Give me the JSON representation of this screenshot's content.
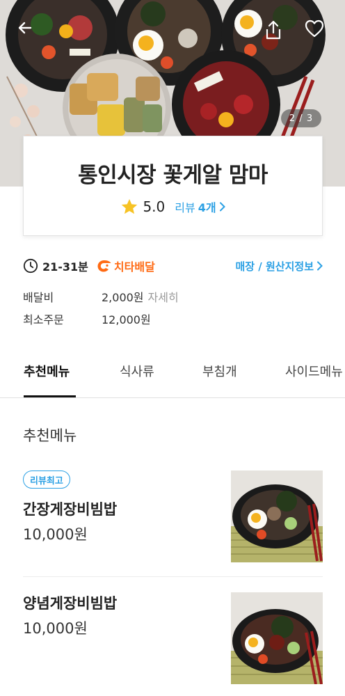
{
  "hero": {
    "image_counter": "2 / 3"
  },
  "store": {
    "name": "통인시장 꽃게알 맘마",
    "rating": "5.0",
    "review_label": "리뷰",
    "review_count": "4개"
  },
  "delivery": {
    "time": "21-31분",
    "cheetah_label": "치타배달",
    "origin_link": "매장 / 원산지정보",
    "fee_label": "배달비",
    "fee_value": "2,000원",
    "fee_detail": "자세히",
    "min_order_label": "최소주문",
    "min_order_value": "12,000원"
  },
  "tabs": [
    {
      "label": "추천메뉴",
      "active": true
    },
    {
      "label": "식사류"
    },
    {
      "label": "부침개"
    },
    {
      "label": "사이드메뉴"
    }
  ],
  "section": {
    "title": "추천메뉴"
  },
  "menu_items": [
    {
      "badge": "리뷰최고",
      "name": "간장게장비빔밥",
      "price": "10,000원"
    },
    {
      "name": "양념게장비빔밥",
      "price": "10,000원"
    }
  ],
  "colors": {
    "accent_blue": "#2ba0e4",
    "cheetah_orange": "#ff6a13",
    "star_yellow": "#f7c325"
  },
  "icons": {
    "back": "arrow-left-icon",
    "share": "share-icon",
    "favorite": "heart-icon",
    "time": "clock-icon",
    "cheetah": "cheetah-icon",
    "star": "star-icon"
  }
}
